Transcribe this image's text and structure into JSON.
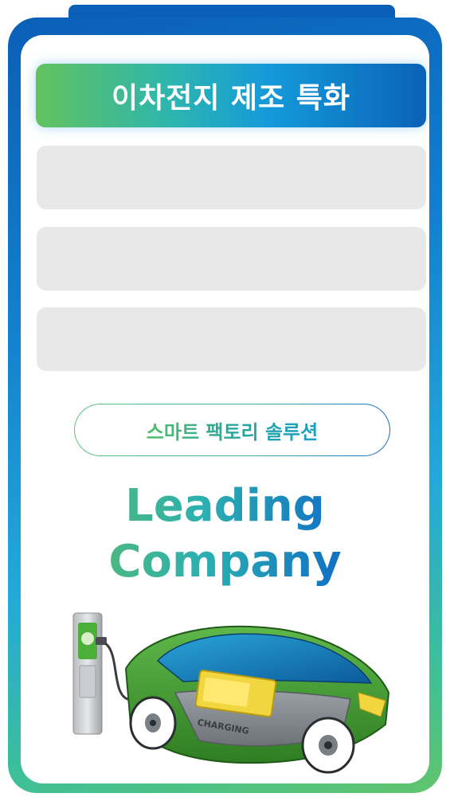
{
  "title_bar": {
    "label": "이차전지 제조 특화"
  },
  "pill": {
    "label": "스마트 팩토리 솔루션"
  },
  "headline": {
    "line1": "Leading",
    "line2": "Company"
  },
  "illustration": {
    "badge_text": "CHARGING",
    "icon": "ev-charging-car-illustration"
  },
  "colors": {
    "frame_blue": "#0b5fb6",
    "accent_green": "#62c25e",
    "accent_cyan": "#1499da",
    "placeholder_gray": "#e8e8e8",
    "car_green": "#3d9a2e"
  }
}
